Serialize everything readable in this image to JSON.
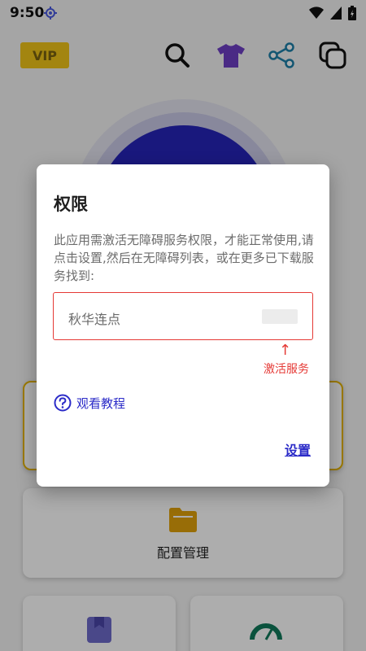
{
  "status_bar": {
    "time": "9:50"
  },
  "toolbar": {
    "vip_label": "VIP"
  },
  "main": {
    "config_label": "配置管理"
  },
  "dialog": {
    "title": "权限",
    "message": "此应用需激活无障碍服务权限，才能正常使用,请点击设置,然后在无障碍列表，或在更多已下载服务找到:",
    "service_name": "秋华连点",
    "arrow": "↑",
    "activate_hint": "激活服务",
    "tutorial_label": "观看教程",
    "settings_label": "设置"
  },
  "colors": {
    "accent": "#2B2BC8",
    "vip": "#F0C419",
    "highlight_red": "#E53935",
    "main_circle": "#2624B8"
  },
  "icons": {
    "status": [
      "location-icon",
      "wifi-icon",
      "signal-icon",
      "battery-icon"
    ],
    "toolbar": [
      "search-icon",
      "tshirt-icon",
      "share-icon",
      "copy-icon"
    ]
  }
}
